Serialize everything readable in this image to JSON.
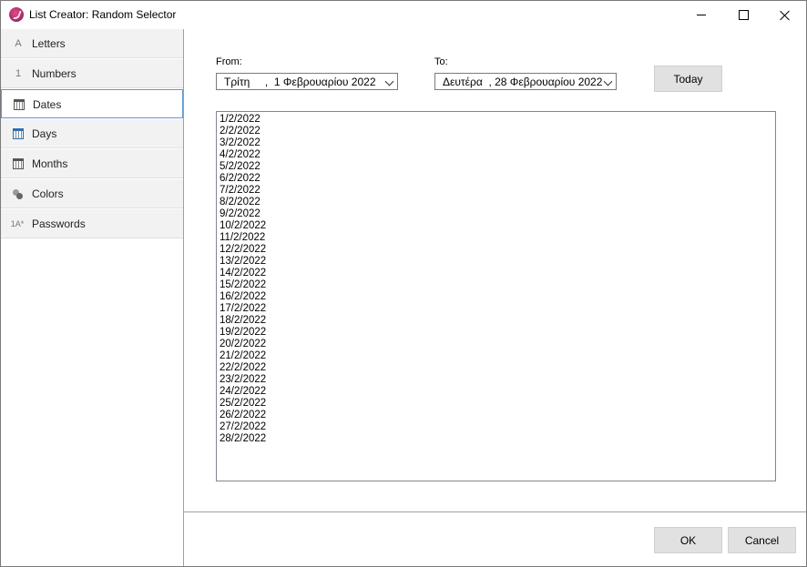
{
  "window": {
    "title": "List Creator: Random Selector"
  },
  "sidebar": {
    "items": [
      {
        "label": "Letters",
        "icon": "letter-a-icon",
        "glyph": "A"
      },
      {
        "label": "Numbers",
        "icon": "digit-one-icon",
        "glyph": "1"
      },
      {
        "label": "Dates",
        "icon": "calendar-icon",
        "active": true
      },
      {
        "label": "Days",
        "icon": "calendar-day-icon"
      },
      {
        "label": "Months",
        "icon": "calendar-month-icon"
      },
      {
        "label": "Colors",
        "icon": "colors-icon"
      },
      {
        "label": "Passwords",
        "icon": "password-icon",
        "glyph": "1A*"
      }
    ]
  },
  "main": {
    "from_label": "From:",
    "from_value": "Τρίτη     ,  1 Φεβρουαρίου 2022",
    "to_label": "To:",
    "to_value": "Δευτέρα  , 28 Φεβρουαρίου 2022",
    "today_button": "Today",
    "dates": [
      "1/2/2022",
      "2/2/2022",
      "3/2/2022",
      "4/2/2022",
      "5/2/2022",
      "6/2/2022",
      "7/2/2022",
      "8/2/2022",
      "9/2/2022",
      "10/2/2022",
      "11/2/2022",
      "12/2/2022",
      "13/2/2022",
      "14/2/2022",
      "15/2/2022",
      "16/2/2022",
      "17/2/2022",
      "18/2/2022",
      "19/2/2022",
      "20/2/2022",
      "21/2/2022",
      "22/2/2022",
      "23/2/2022",
      "24/2/2022",
      "25/2/2022",
      "26/2/2022",
      "27/2/2022",
      "28/2/2022"
    ]
  },
  "footer": {
    "ok_button": "OK",
    "cancel_button": "Cancel"
  }
}
